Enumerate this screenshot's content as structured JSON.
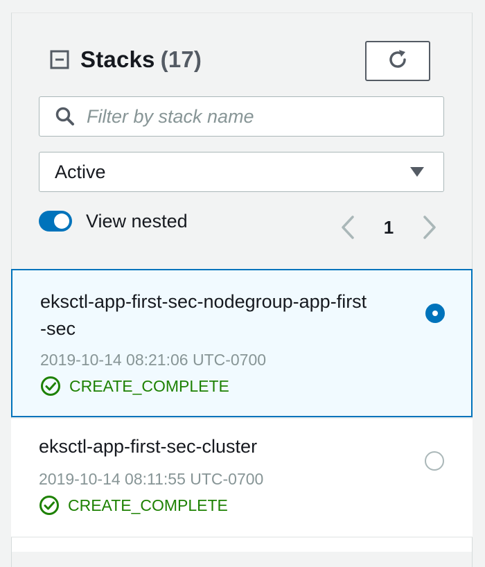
{
  "panel": {
    "title": "Stacks",
    "count": "(17)"
  },
  "search": {
    "placeholder": "Filter by stack name",
    "value": ""
  },
  "filter": {
    "selected": "Active"
  },
  "view_nested": {
    "label": "View nested",
    "enabled": true
  },
  "pagination": {
    "current_page": "1"
  },
  "stacks": [
    {
      "name": "eksctl-app-first-sec-nodegroup-app-first-sec",
      "name_line1": "eksctl-app-first-sec-nodegroup-app-first",
      "name_line2": "-sec",
      "created": "2019-10-14 08:21:06 UTC-0700",
      "status": "CREATE_COMPLETE",
      "selected": true
    },
    {
      "name": "eksctl-app-first-sec-cluster",
      "created": "2019-10-14 08:11:55 UTC-0700",
      "status": "CREATE_COMPLETE",
      "selected": false
    }
  ],
  "icons": {
    "collapse": "collapse-icon",
    "refresh": "refresh-icon",
    "search": "search-icon",
    "caret": "caret-down-icon",
    "prev": "chevron-left-icon",
    "next": "chevron-right-icon",
    "status_ok": "check-circle-icon"
  },
  "colors": {
    "accent": "#0073bb",
    "success": "#1d8102",
    "selected_bg": "#f1faff",
    "muted_text": "#879596"
  }
}
